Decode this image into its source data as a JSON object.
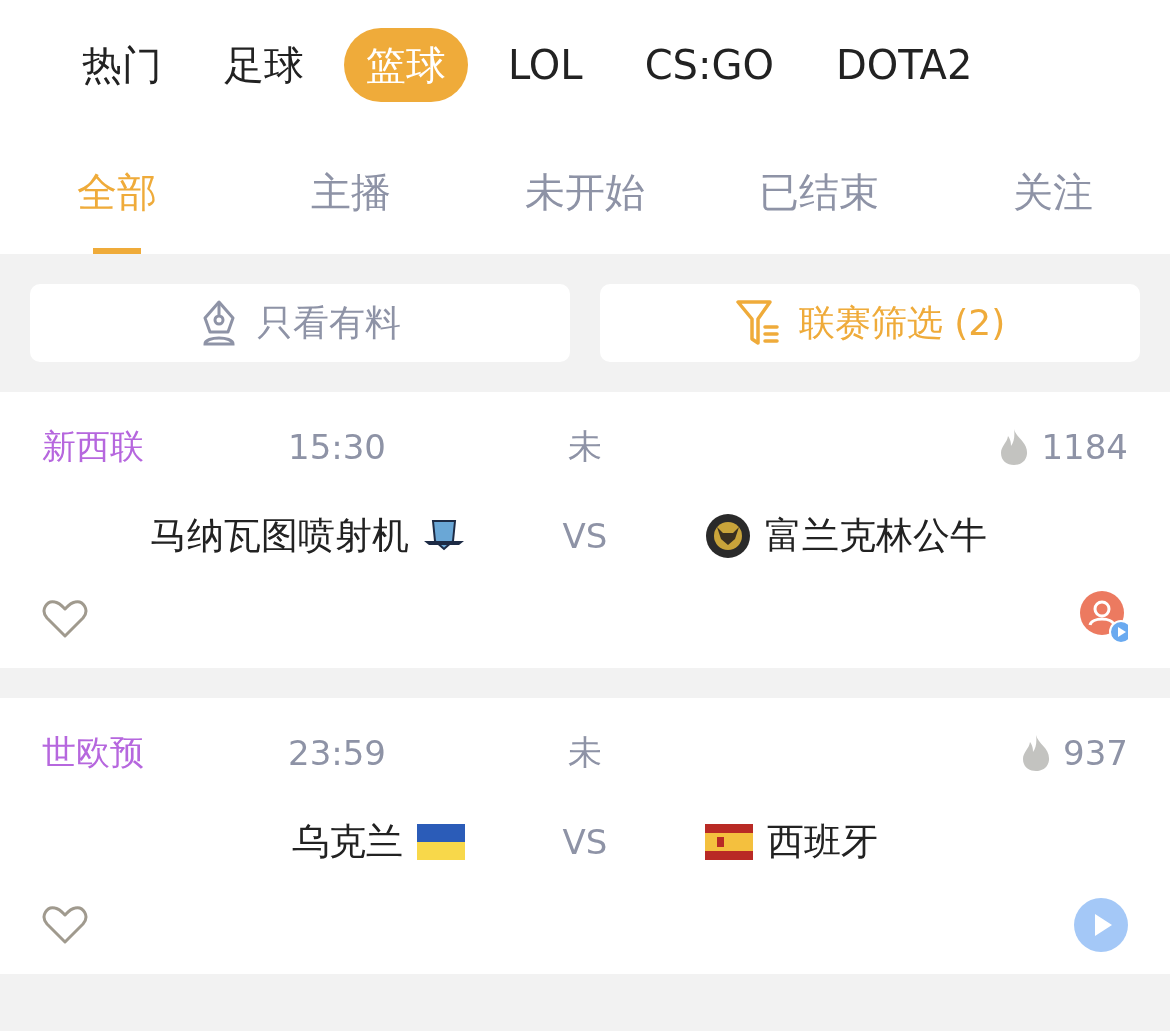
{
  "sport_tabs": [
    {
      "label": "热门",
      "selected": false
    },
    {
      "label": "足球",
      "selected": false
    },
    {
      "label": "篮球",
      "selected": true
    },
    {
      "label": "LOL",
      "selected": false
    },
    {
      "label": "CS:GO",
      "selected": false
    },
    {
      "label": "DOTA2",
      "selected": false
    }
  ],
  "filter_tabs": [
    {
      "label": "全部",
      "selected": true
    },
    {
      "label": "主播",
      "selected": false
    },
    {
      "label": "未开始",
      "selected": false
    },
    {
      "label": "已结束",
      "selected": false
    },
    {
      "label": "关注",
      "selected": false
    }
  ],
  "filters": [
    {
      "kind": "material",
      "label": "只看有料",
      "active": false
    },
    {
      "kind": "league",
      "label": "联赛筛选 (2)",
      "active": true
    }
  ],
  "matches": [
    {
      "league": "新西联",
      "time": "15:30",
      "status": "未",
      "heat": "1184",
      "versus": "VS",
      "favorited": false,
      "action": {
        "kind": "anchor"
      },
      "home": {
        "name": "马纳瓦图喷射机",
        "kind": "shield"
      },
      "away": {
        "name": "富兰克林公牛",
        "kind": "badge"
      }
    },
    {
      "league": "世欧预",
      "time": "23:59",
      "status": "未",
      "heat": "937",
      "versus": "VS",
      "favorited": false,
      "action": {
        "kind": "play"
      },
      "home": {
        "name": "乌克兰",
        "kind": "flag_ua"
      },
      "away": {
        "name": "西班牙",
        "kind": "flag_es"
      }
    }
  ]
}
